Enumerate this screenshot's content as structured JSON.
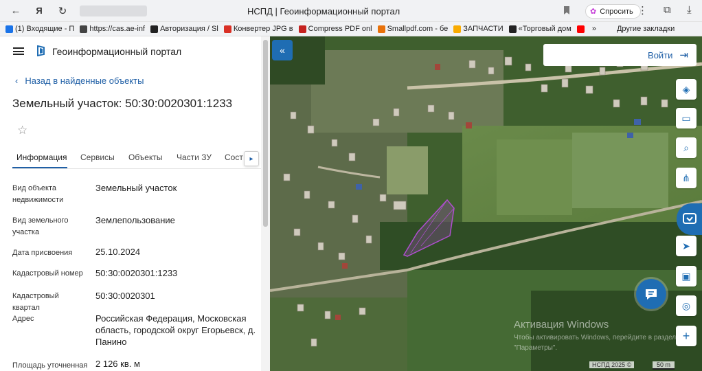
{
  "browser": {
    "tab_title": "НСПД | Геоинформационный портал",
    "ask_label": "Спросить"
  },
  "bookmarks": [
    {
      "label": "(1) Входящие - П",
      "color": "#1a73e8"
    },
    {
      "label": "https://cas.ae-inf",
      "color": "#444444"
    },
    {
      "label": "Авторизация / Sl",
      "color": "#222222"
    },
    {
      "label": "Конвертер JPG в",
      "color": "#d93025"
    },
    {
      "label": "Compress PDF onl",
      "color": "#c5221f"
    },
    {
      "label": "Smallpdf.com - бе",
      "color": "#e8710a"
    },
    {
      "label": "ЗАПЧАСТИ",
      "color": "#f9ab00"
    },
    {
      "label": "«Торговый дом",
      "color": "#222222"
    },
    {
      "label": "",
      "color": "#ff0000"
    }
  ],
  "bookmarks_more": "»",
  "bookmarks_other": "Другие закладки",
  "panel": {
    "portal_title": "Геоинформационный портал",
    "back_link": "Назад в найденные объекты",
    "page_title": "Земельный участок: 50:30:0020301:1233",
    "tabs": [
      "Информация",
      "Сервисы",
      "Объекты",
      "Части ЗУ",
      "Сост"
    ],
    "rows": [
      {
        "label": "Вид объекта недвижимости",
        "value": "Земельный участок"
      },
      {
        "label": "Вид земельного участка",
        "value": "Землепользование"
      },
      {
        "label": "Дата присвоения",
        "value": "25.10.2024"
      },
      {
        "label": "Кадастровый номер",
        "value": "50:30:0020301:1233"
      },
      {
        "label": "Кадастровый квартал",
        "value": "50:30:0020301"
      },
      {
        "label": "Адрес",
        "value": "Российская Федерация, Московская область, городской округ Егорьевск, д. Панино"
      },
      {
        "label": "Площадь уточненная",
        "value": "2 126 кв. м"
      }
    ]
  },
  "map": {
    "login_label": "Войти",
    "watermark_title": "Активация Windows",
    "watermark_text": "Чтобы активировать Windows, перейдите в раздел \"Параметры\".",
    "copyright": "НСПД 2025 ©",
    "scale": "50 m",
    "colors": {
      "accent": "#1f6db3",
      "parcel": "#b04fd0"
    }
  }
}
